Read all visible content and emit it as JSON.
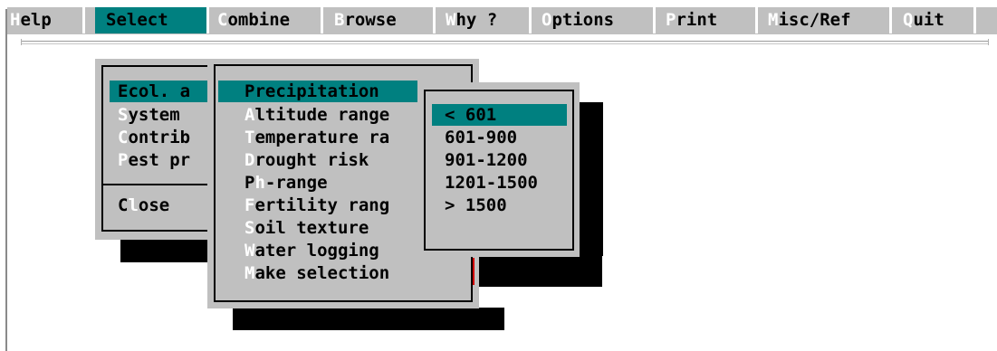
{
  "menubar": {
    "items": [
      {
        "key": "H",
        "rest": "elp"
      },
      {
        "key": "S",
        "rest": "elect"
      },
      {
        "key": "C",
        "rest": "ombine"
      },
      {
        "key": "B",
        "rest": "rowse"
      },
      {
        "key": "W",
        "rest": "hy ?"
      },
      {
        "key": "O",
        "rest": "ptions"
      },
      {
        "key": "P",
        "rest": "rint"
      },
      {
        "key": "M",
        "rest": "isc/Ref"
      },
      {
        "key": "Q",
        "rest": "uit"
      }
    ],
    "selected": "Select"
  },
  "select_menu": {
    "items": [
      {
        "full": "Ecol. a"
      },
      {
        "key": "S",
        "rest": "ystem"
      },
      {
        "key": "C",
        "rest": "ontrib"
      },
      {
        "key": "P",
        "rest": "est pr"
      }
    ],
    "close": {
      "pre": "C",
      "key": "l",
      "post": "ose"
    }
  },
  "ecol_menu": {
    "items": [
      {
        "full": "Precipitation"
      },
      {
        "key": "A",
        "rest": "ltitude range"
      },
      {
        "key": "T",
        "rest": "emperature ra"
      },
      {
        "key": "D",
        "rest": "rought risk"
      },
      {
        "pre": "P",
        "key": "h",
        "rest": "-range"
      },
      {
        "key": "F",
        "rest": "ertility rang"
      },
      {
        "key": "S",
        "rest": "oil texture"
      },
      {
        "key": "W",
        "rest": "ater logging"
      },
      {
        "key": "M",
        "rest": "ake selection"
      }
    ]
  },
  "precip_menu": {
    "items": [
      "< 601",
      "601-900",
      "901-1200",
      "1201-1500",
      "> 1500"
    ],
    "selected_index": 0
  },
  "colors": {
    "menu_bg": "#c0c0c0",
    "highlight": "#008080",
    "hotkey": "#ffffff",
    "shadow": "#000000"
  }
}
